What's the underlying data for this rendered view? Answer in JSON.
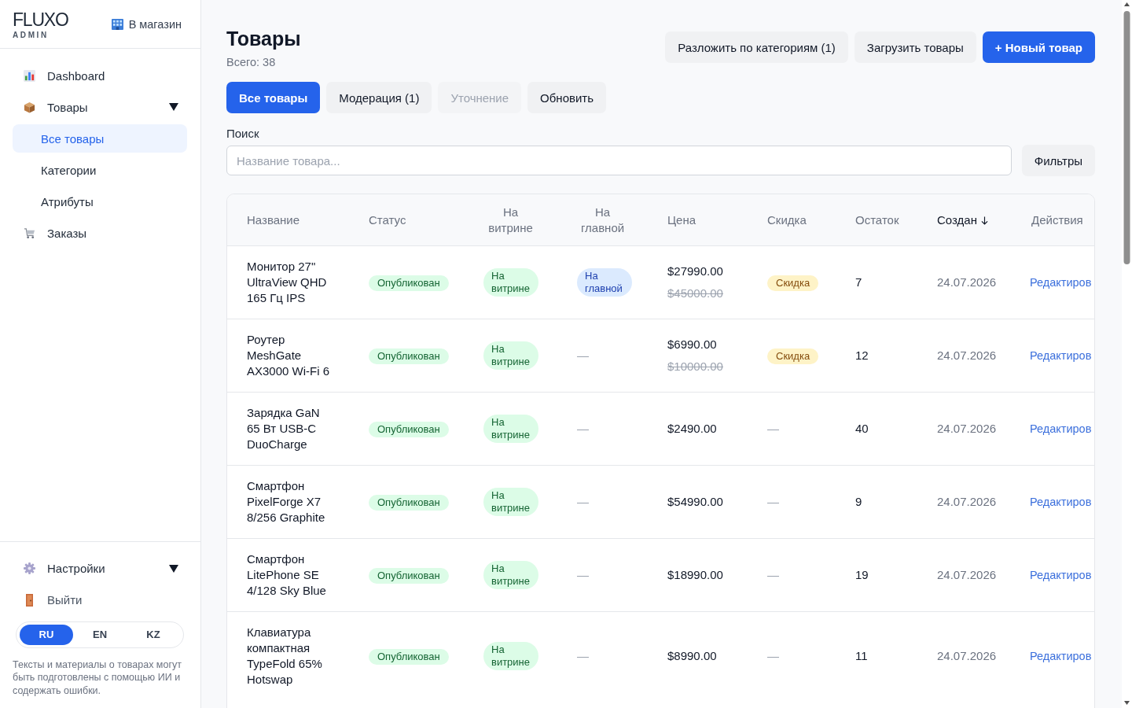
{
  "sidebar": {
    "brand": {
      "logo": "FLUXO",
      "subtitle": "ADMIN"
    },
    "store_link": "В магазин",
    "nav": [
      {
        "label": "Dashboard",
        "kind": "link",
        "selected": false
      },
      {
        "label": "Товары",
        "kind": "group",
        "selected": false,
        "children": [
          {
            "label": "Все товары",
            "selected": true
          },
          {
            "label": "Категории",
            "selected": false
          },
          {
            "label": "Атрибуты",
            "selected": false
          }
        ]
      },
      {
        "label": "Заказы",
        "kind": "link",
        "selected": false
      }
    ],
    "footer_menu": [
      {
        "label": "Настройки",
        "kind": "group"
      },
      {
        "label": "Выйти",
        "kind": "link"
      }
    ],
    "languages": [
      {
        "label": "RU",
        "selected": true
      },
      {
        "label": "EN",
        "selected": false
      },
      {
        "label": "KZ",
        "selected": false
      }
    ],
    "disclaimer": "Тексты и материалы о товарах могут быть подготовлены с помощью ИИ и содержать ошибки."
  },
  "header": {
    "title": "Товары",
    "total": "Всего: 38",
    "actions": [
      {
        "label": "Разложить по категориям (1)",
        "kind": "secondary"
      },
      {
        "label": "Загрузить товары",
        "kind": "secondary"
      },
      {
        "label": "+ Новый товар",
        "kind": "primary"
      }
    ]
  },
  "tabs": [
    {
      "label": "Все товары",
      "selected": true,
      "disabled": false
    },
    {
      "label": "Модерация (1)",
      "selected": false,
      "disabled": false
    },
    {
      "label": "Уточнение",
      "selected": false,
      "disabled": true
    }
  ],
  "refresh_button": "Обновить",
  "search": {
    "label": "Поиск",
    "placeholder": "Название товара...",
    "filters_button": "Фильтры"
  },
  "table": {
    "columns": [
      {
        "label": "Название",
        "sorted": false
      },
      {
        "label": "Статус",
        "sorted": false
      },
      {
        "label": "На витрине",
        "sorted": false
      },
      {
        "label": "На главной",
        "sorted": false
      },
      {
        "label": "Цена",
        "sorted": false
      },
      {
        "label": "Скидка",
        "sorted": false
      },
      {
        "label": "Остаток",
        "sorted": false
      },
      {
        "label": "Создан",
        "sorted": true
      },
      {
        "label": "Действия",
        "sorted": false
      }
    ],
    "rows": [
      {
        "name": "Монитор 27\" UltraView QHD 165 Гц IPS",
        "status": "Опубликован",
        "showcase": {
          "kind": "badge",
          "text": "На витрине"
        },
        "featured": {
          "kind": "badge",
          "text": "На главной"
        },
        "price": "$27990.00",
        "old_price": "$45000.00",
        "discount": {
          "kind": "badge",
          "text": "Скидка"
        },
        "stock": "7",
        "created": "24.07.2026",
        "action": "Редактиров"
      },
      {
        "name": "Роутер MeshGate AX3000 Wi-Fi 6",
        "status": "Опубликован",
        "showcase": {
          "kind": "badge",
          "text": "На витрине"
        },
        "featured": {
          "kind": "dash",
          "text": "—"
        },
        "price": "$6990.00",
        "old_price": "$10000.00",
        "discount": {
          "kind": "badge",
          "text": "Скидка"
        },
        "stock": "12",
        "created": "24.07.2026",
        "action": "Редактиров"
      },
      {
        "name": "Зарядка GaN 65 Вт USB-C DuoCharge",
        "status": "Опубликован",
        "showcase": {
          "kind": "badge",
          "text": "На витрине"
        },
        "featured": {
          "kind": "dash",
          "text": "—"
        },
        "price": "$2490.00",
        "discount": {
          "kind": "dash",
          "text": "—"
        },
        "stock": "40",
        "created": "24.07.2026",
        "action": "Редактиров"
      },
      {
        "name": "Смартфон PixelForge X7 8/256 Graphite",
        "status": "Опубликован",
        "showcase": {
          "kind": "badge",
          "text": "На витрине"
        },
        "featured": {
          "kind": "dash",
          "text": "—"
        },
        "price": "$54990.00",
        "discount": {
          "kind": "dash",
          "text": "—"
        },
        "stock": "9",
        "created": "24.07.2026",
        "action": "Редактиров"
      },
      {
        "name": "Смартфон LitePhone SE 4/128 Sky Blue",
        "status": "Опубликован",
        "showcase": {
          "kind": "badge",
          "text": "На витрине"
        },
        "featured": {
          "kind": "dash",
          "text": "—"
        },
        "price": "$18990.00",
        "discount": {
          "kind": "dash",
          "text": "—"
        },
        "stock": "19",
        "created": "24.07.2026",
        "action": "Редактиров"
      },
      {
        "name": "Клавиатура компактная TypeFold 65% Hotswap",
        "status": "Опубликован",
        "showcase": {
          "kind": "badge",
          "text": "На витрине"
        },
        "featured": {
          "kind": "dash",
          "text": "—"
        },
        "price": "$8990.00",
        "discount": {
          "kind": "dash",
          "text": "—"
        },
        "stock": "11",
        "created": "24.07.2026",
        "action": "Редактиров"
      }
    ]
  }
}
